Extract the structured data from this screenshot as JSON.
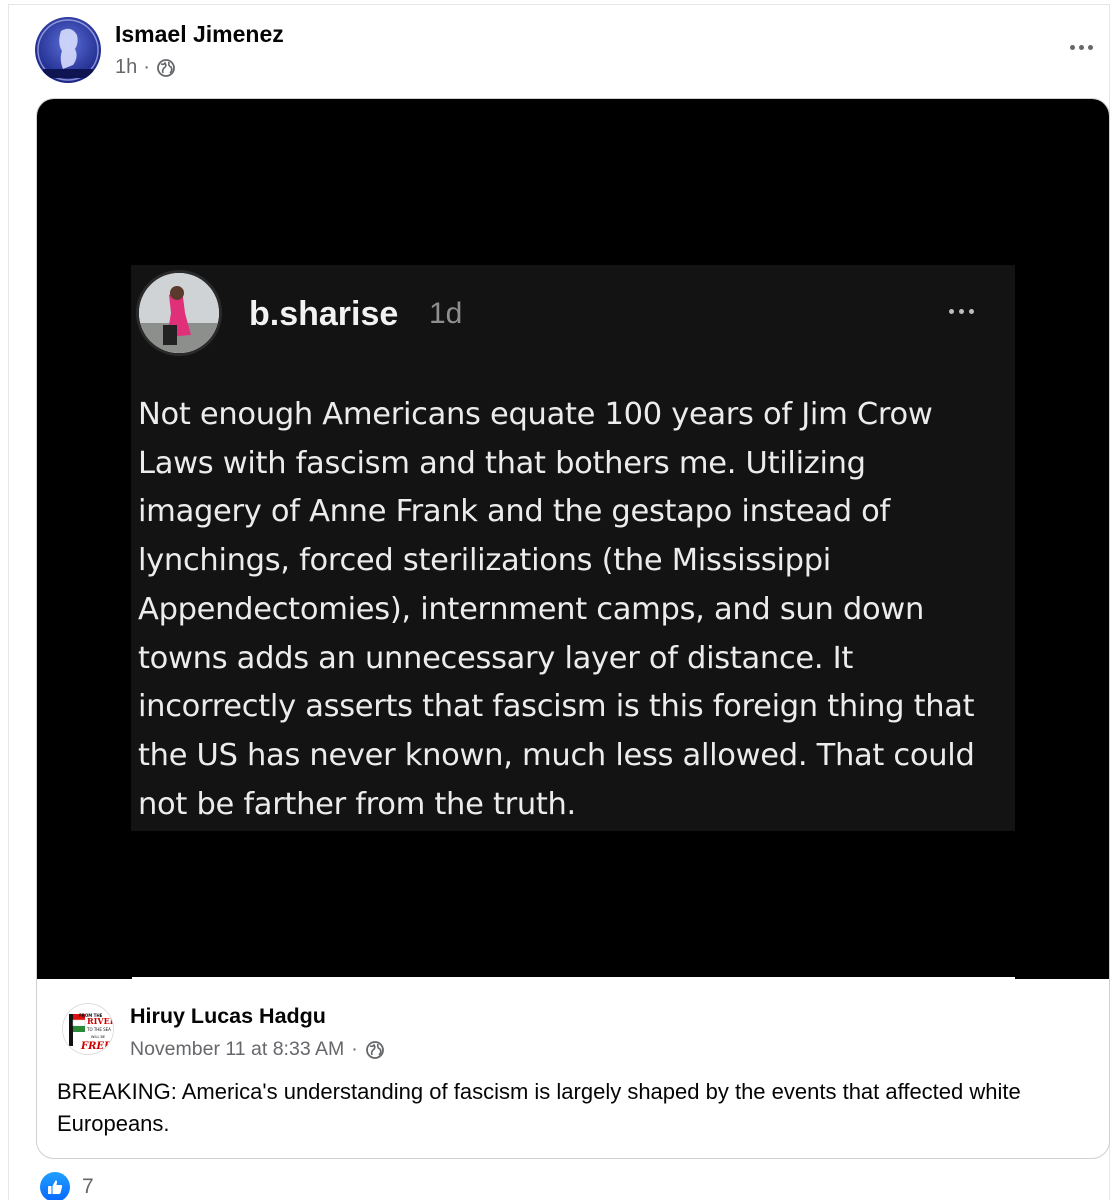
{
  "post": {
    "author": "Ismael Jimenez",
    "time": "1h",
    "separator": "·",
    "privacy_icon": "globe-icon",
    "more_icon": "more-horizontal-icon"
  },
  "image": {
    "username": "b.sharise",
    "time": "1d",
    "more_icon": "more-horizontal-icon",
    "text": "Not enough Americans equate 100 years of Jim Crow Laws with fascism and that bothers me. Utilizing imagery of Anne Frank and the gestapo instead of lynchings, forced sterilizations (the Mississippi Appendectomies), internment camps, and sun down towns adds an unnecessary layer of distance. It incorrectly asserts that fascism is this foreign thing that the US has never known, much less allowed. That could not be farther from the truth."
  },
  "shared": {
    "author": "Hiruy Lucas Hadgu",
    "date": "November 11 at 8:33 AM",
    "separator": "·",
    "privacy_icon": "globe-icon",
    "avatar_text": [
      "FROM THE",
      "RIVER",
      "TO THE SEA",
      "WILL BE",
      "FREE"
    ],
    "text": "BREAKING: America's understanding of fascism is largely shaped by the events that affected white Europeans."
  },
  "reactions": {
    "icon": "like-icon",
    "count": "7"
  },
  "colors": {
    "like": "#0866ff",
    "meta": "#65676b",
    "media_bg": "#000000"
  }
}
